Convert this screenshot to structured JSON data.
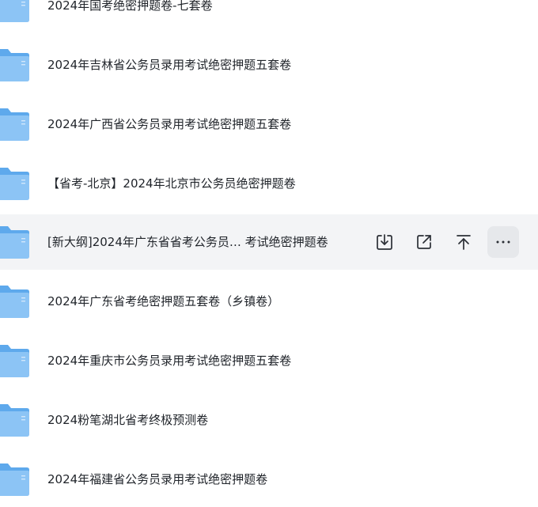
{
  "files": [
    {
      "name": "2024年国考绝密押题卷-七套卷"
    },
    {
      "name": "2024年吉林省公务员录用考试绝密押题五套卷"
    },
    {
      "name": "2024年广西省公务员录用考试绝密押题五套卷"
    },
    {
      "name": "【省考-北京】2024年北京市公务员绝密押题卷"
    },
    {
      "name": "[新大纲]2024年广东省省考公务员…  考试绝密押题卷"
    },
    {
      "name": "2024年广东省考绝密押题五套卷（乡镇卷）"
    },
    {
      "name": "2024年重庆市公务员录用考试绝密押题五套卷"
    },
    {
      "name": "2024粉笔湖北省考终极预测卷"
    },
    {
      "name": "2024年福建省公务员录用考试绝密押题卷"
    }
  ],
  "hovered_index": 4,
  "row_actions": [
    "download-icon",
    "share-icon",
    "pin-to-top-icon",
    "more-icon"
  ],
  "colors": {
    "folder_front": "#8cc4f5",
    "folder_back": "#5ea9ec",
    "hover_bg": "#f3f4f6"
  }
}
